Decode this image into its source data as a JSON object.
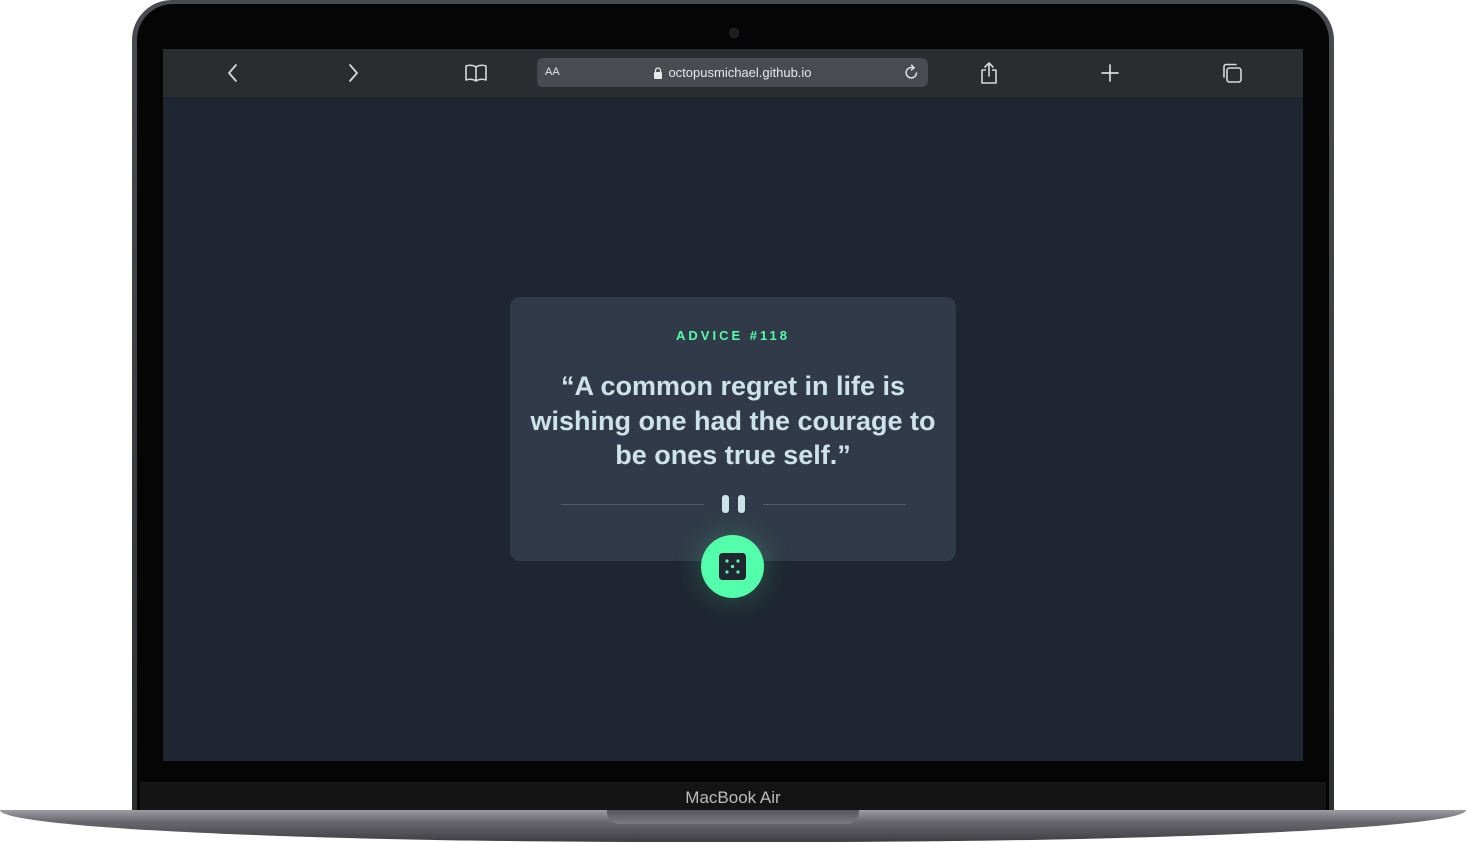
{
  "device": {
    "model_label": "MacBook Air"
  },
  "browser": {
    "text_size_label": "AA",
    "url": "octopusmichael.github.io",
    "icons": {
      "back": "chevron-left-icon",
      "forward": "chevron-right-icon",
      "bookmarks": "book-icon",
      "lock": "lock-icon",
      "reload": "reload-icon",
      "share": "share-icon",
      "new_tab": "plus-icon",
      "tabs": "tabs-icon"
    }
  },
  "advice": {
    "id_label": "ADVICE #118",
    "quote": "“A common regret in life is wishing one had the courage to be ones true self.”",
    "divider_icon": "pause-icon",
    "button_icon": "dice-icon"
  },
  "colors": {
    "page_background": "#1f2631",
    "card_background": "#313a48",
    "accent_green": "#53ffaa",
    "quote_text": "#cee3e9",
    "toolbar_background": "#2b2c30"
  }
}
